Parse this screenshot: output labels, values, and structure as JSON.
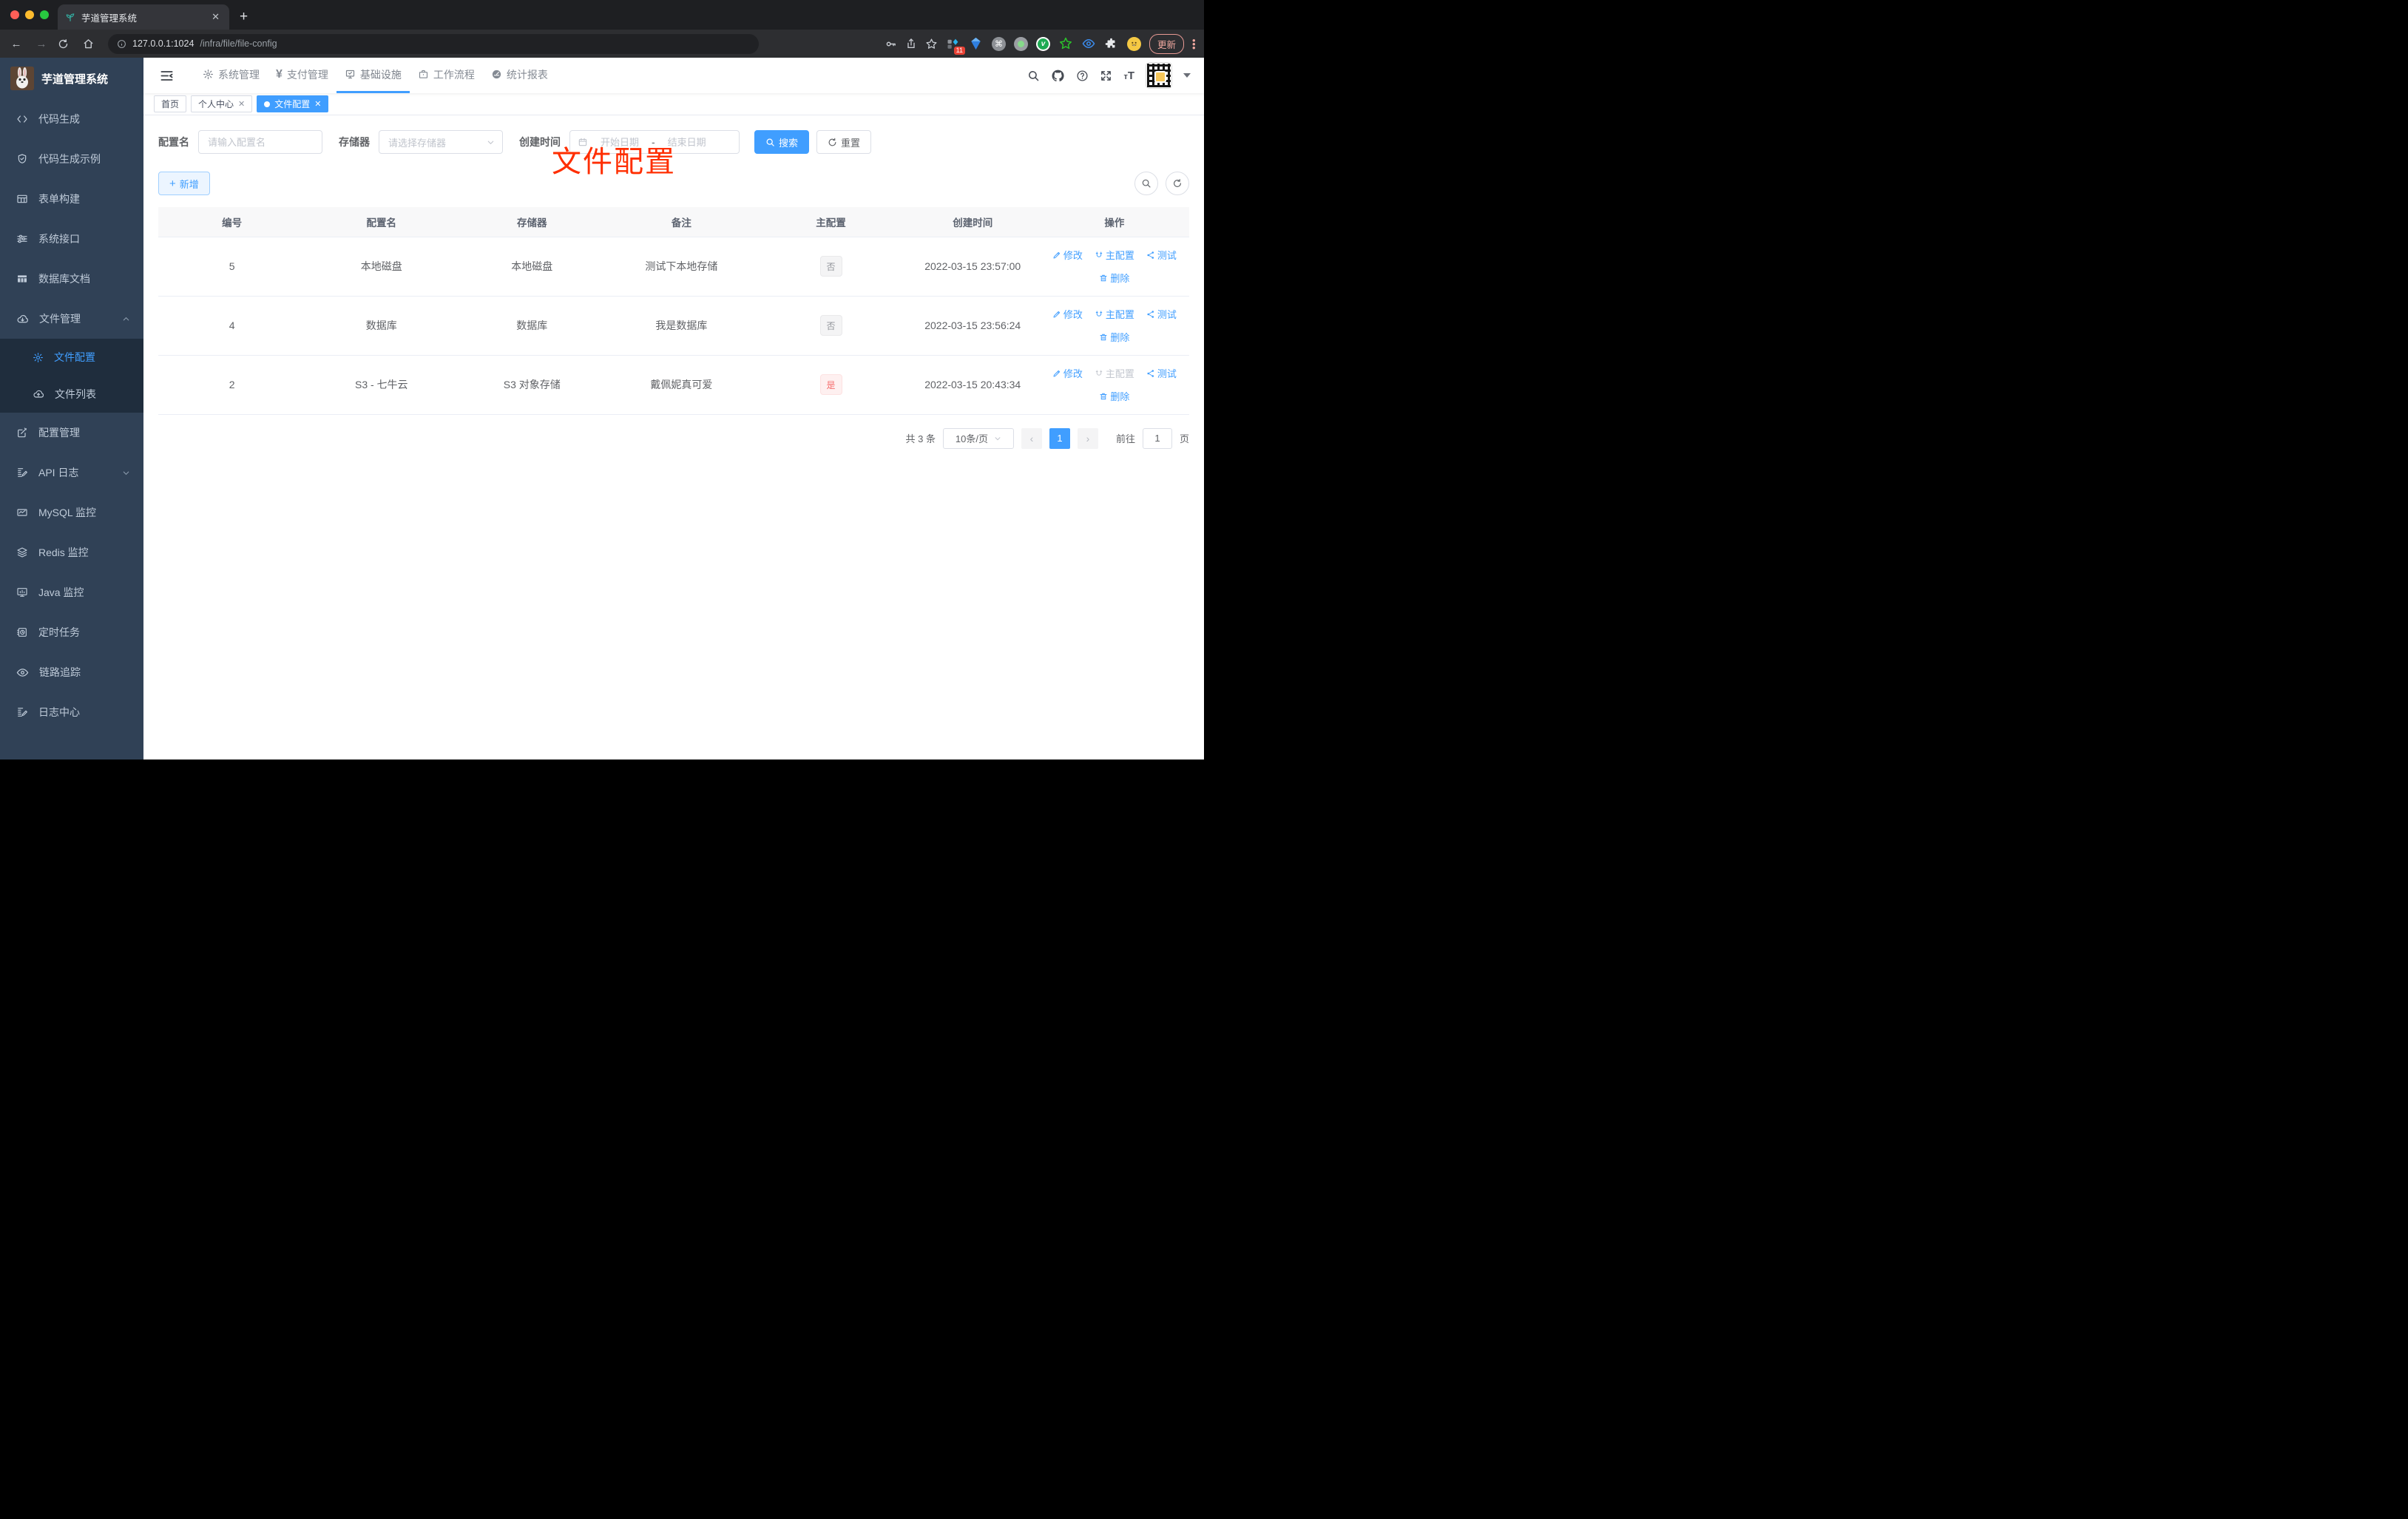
{
  "browser": {
    "tab_title": "芋道管理系统",
    "url_host": "127.0.0.1:1024",
    "url_path": "/infra/file/file-config",
    "update_label": "更新",
    "ext_badge": "11"
  },
  "sidebar": {
    "title": "芋道管理系统",
    "items": [
      {
        "label": "代码生成",
        "icon": "code-icon"
      },
      {
        "label": "代码生成示例",
        "icon": "shield-check-icon"
      },
      {
        "label": "表单构建",
        "icon": "form-grid-icon"
      },
      {
        "label": "系统接口",
        "icon": "sliders-icon"
      },
      {
        "label": "数据库文档",
        "icon": "table-solid-icon"
      },
      {
        "label": "文件管理",
        "icon": "cloud-download-icon"
      }
    ],
    "submenu": [
      {
        "label": "文件配置",
        "icon": "gear-icon",
        "active": true
      },
      {
        "label": "文件列表",
        "icon": "cloud-upload-icon",
        "active": false
      }
    ],
    "items_lower": [
      {
        "label": "配置管理",
        "icon": "edit-square-icon"
      },
      {
        "label": "API 日志",
        "icon": "doc-edit-icon"
      },
      {
        "label": "MySQL 监控",
        "icon": "chart-icon"
      },
      {
        "label": "Redis 监控",
        "icon": "layers-icon"
      },
      {
        "label": "Java 监控",
        "icon": "monitor-icon"
      },
      {
        "label": "定时任务",
        "icon": "timer-icon"
      },
      {
        "label": "链路追踪",
        "icon": "eye-icon"
      },
      {
        "label": "日志中心",
        "icon": "doc-edit-icon"
      }
    ]
  },
  "nav": {
    "items": [
      {
        "label": "系统管理",
        "icon": "gear-icon"
      },
      {
        "label": "支付管理",
        "icon": "yen-icon"
      },
      {
        "label": "基础设施",
        "icon": "monitor-check-icon",
        "active": true
      },
      {
        "label": "工作流程",
        "icon": "briefcase-icon"
      },
      {
        "label": "统计报表",
        "icon": "gauge-icon"
      }
    ]
  },
  "tags": {
    "home": "首页",
    "profile": "个人中心",
    "file_config": "文件配置"
  },
  "annotation": "文件配置",
  "filters": {
    "name_label": "配置名",
    "name_placeholder": "请输入配置名",
    "storage_label": "存储器",
    "storage_placeholder": "请选择存储器",
    "date_label": "创建时间",
    "date_start_placeholder": "开始日期",
    "date_separator": "-",
    "date_end_placeholder": "结束日期",
    "search_label": "搜索",
    "reset_label": "重置"
  },
  "toolbar": {
    "add_label": "新增"
  },
  "table": {
    "headers": [
      "编号",
      "配置名",
      "存储器",
      "备注",
      "主配置",
      "创建时间",
      "操作"
    ],
    "action_labels": {
      "edit": "修改",
      "master": "主配置",
      "test": "测试",
      "delete": "删除"
    },
    "rows": [
      {
        "id": "5",
        "name": "本地磁盘",
        "storage": "本地磁盘",
        "remark": "测试下本地存储",
        "master": "否",
        "time": "2022-03-15 23:57:00"
      },
      {
        "id": "4",
        "name": "数据库",
        "storage": "数据库",
        "remark": "我是数据库",
        "master": "否",
        "time": "2022-03-15 23:56:24"
      },
      {
        "id": "2",
        "name": "S3 - 七牛云",
        "storage": "S3 对象存储",
        "remark": "戴佩妮真可爱",
        "master": "是",
        "time": "2022-03-15 20:43:34"
      }
    ]
  },
  "pagination": {
    "total": "共 3 条",
    "page_size": "10条/页",
    "page": "1",
    "goto_label": "前往",
    "goto_value": "1",
    "page_unit": "页"
  },
  "colors": {
    "accent": "#409eff",
    "danger": "#f56c6c",
    "sidebar_bg": "#304156",
    "submenu_bg": "#1f2d3d",
    "annotation": "#ff2e00"
  }
}
